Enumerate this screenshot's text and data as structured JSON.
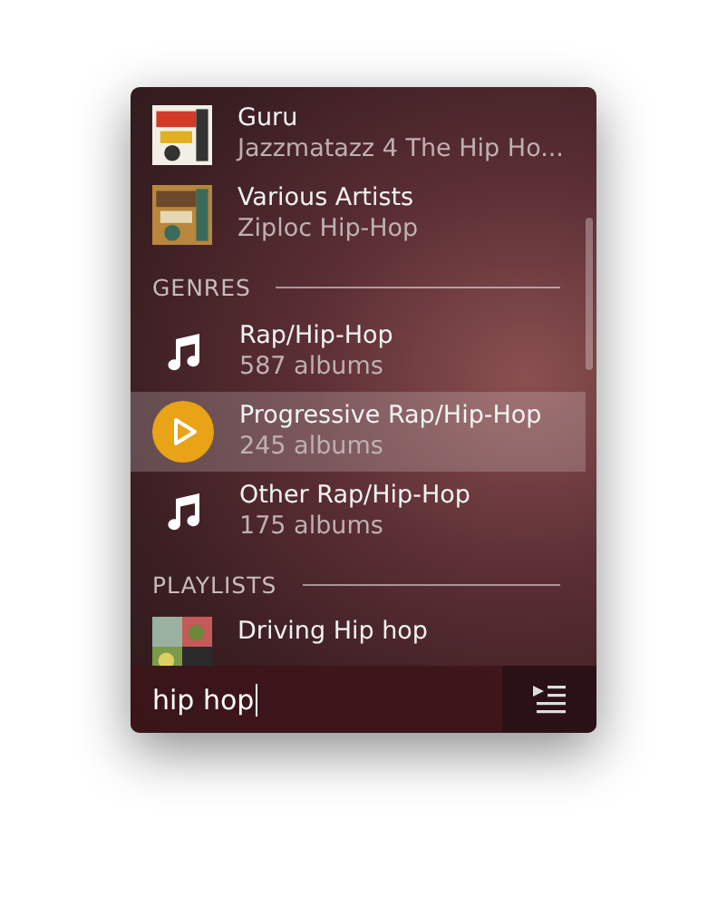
{
  "albums": [
    {
      "kind": "picture",
      "title": "Guru",
      "subtitle": "Jazzmatazz 4 The Hip Ho..."
    },
    {
      "kind": "picture",
      "title": "Various Artists",
      "subtitle": "Ziploc Hip-Hop"
    }
  ],
  "genres": {
    "heading": "GENRES",
    "items": [
      {
        "title": "Rap/Hip-Hop",
        "subtitle": "587 albums",
        "selected": false
      },
      {
        "title": "Progressive Rap/Hip-Hop",
        "subtitle": "245 albums",
        "selected": true
      },
      {
        "title": "Other Rap/Hip-Hop",
        "subtitle": "175 albums",
        "selected": false
      }
    ]
  },
  "playlists": {
    "heading": "PLAYLISTS",
    "items": [
      {
        "kind": "picture",
        "title": "Driving Hip hop"
      }
    ]
  },
  "search": {
    "value": "hip hop"
  }
}
